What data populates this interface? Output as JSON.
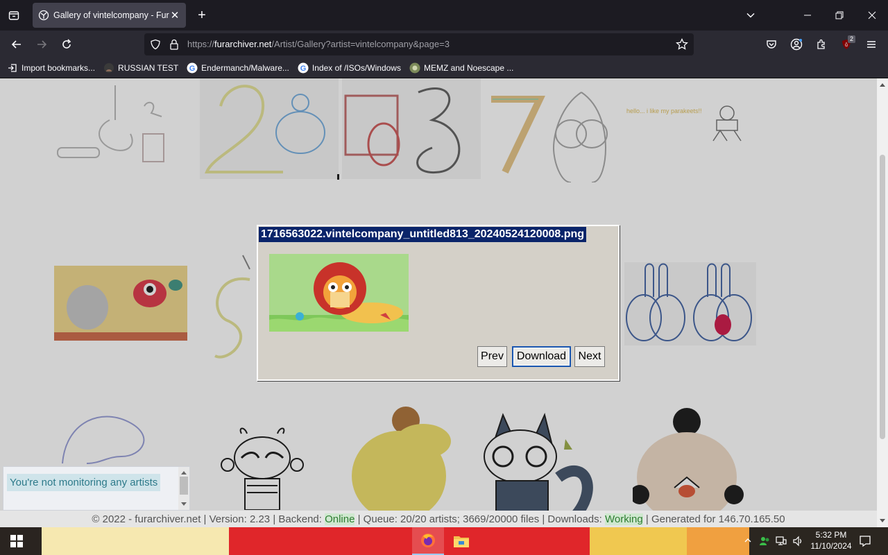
{
  "browser": {
    "tab_title": "Gallery of vintelcompany - Fura",
    "url_prefix": "https://",
    "url_domain": "furarchiver.net",
    "url_path": "/Artist/Gallery?artist=vintelcompany&page=3",
    "ext_badge": "2"
  },
  "bookmarks": [
    {
      "label": "Import bookmarks..."
    },
    {
      "label": "RUSSIAN TEST"
    },
    {
      "label": "Endermanch/Malware..."
    },
    {
      "label": "Index of /ISOs/Windows"
    },
    {
      "label": "MEMZ and Noescape ..."
    }
  ],
  "dialog": {
    "title": "1716563022.vintelcompany_untitled813_20240524120008.png",
    "prev_label": "Prev",
    "download_label": "Download",
    "next_label": "Next"
  },
  "gallery": {
    "sketch_note": "hello... i like my parakeets!!"
  },
  "monitor": {
    "text": "You're not monitoring any artists"
  },
  "footer": {
    "prefix": "© 2022 - furarchiver.net | Version: 2.23 | Backend: ",
    "backend_status": "Online",
    "queue": " | Queue: 20/20 artists; 3669/20000 files | Downloads: ",
    "downloads_status": "Working",
    "generated": " | Generated for 146.70.165.50"
  },
  "taskbar": {
    "time": "5:32 PM",
    "date": "11/10/2024"
  },
  "colors": {
    "dialog_title_bg": "#0a246a",
    "status_ok": "#2e7d32"
  }
}
